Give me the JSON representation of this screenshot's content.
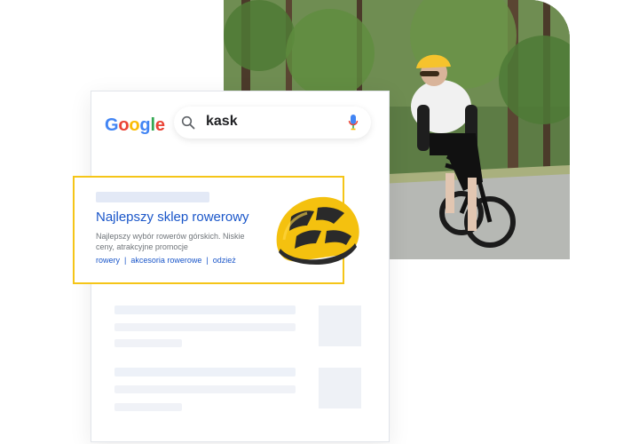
{
  "search": {
    "logo_letters": [
      "G",
      "o",
      "o",
      "g",
      "l",
      "e"
    ],
    "query": "kask",
    "search_icon": "search-icon",
    "mic_icon": "mic-icon"
  },
  "ad": {
    "title": "Najlepszy sklep rowerowy",
    "description": "Najlepszy wybór rowerów górskich. Niskie ceny, atrakcyjne promocje",
    "links": [
      "rowery",
      "akcesoria rowerowe",
      "odzież"
    ],
    "separator": "|",
    "image": "bike-helmet-image",
    "highlight_color": "#F5C518"
  },
  "photo": {
    "subject": "cyclist-photo"
  },
  "colors": {
    "link_blue": "#1A56C9",
    "google_blue": "#4285F4",
    "google_red": "#EA4335",
    "google_yellow": "#FBBC05",
    "google_green": "#34A853"
  }
}
